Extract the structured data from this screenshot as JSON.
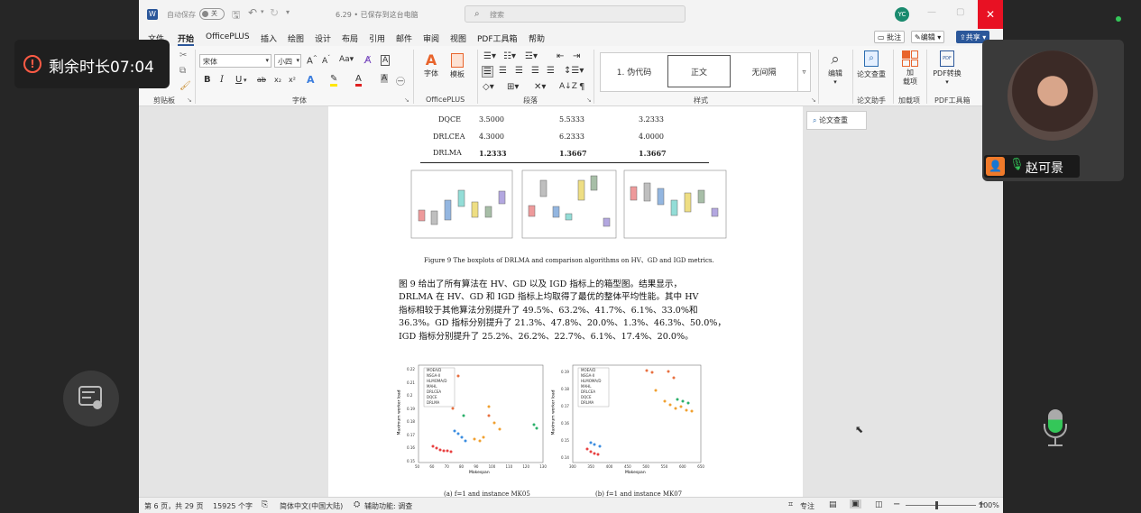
{
  "word": {
    "autosave_label": "自动保存",
    "autosave_state": "关",
    "doc_title": "6.29 • 已保存到这台电脑",
    "search_placeholder": "搜索",
    "user_initials": "YC",
    "menu": [
      "文件",
      "开始",
      "OfficePLUS",
      "插入",
      "绘图",
      "设计",
      "布局",
      "引用",
      "邮件",
      "审阅",
      "视图",
      "PDF工具箱",
      "帮助"
    ],
    "menu_active": "开始",
    "right_buttons": {
      "comment": "批注",
      "edit": "编辑",
      "share": "共享"
    },
    "ribbon": {
      "paste": "粘贴",
      "clipboard": "剪贴板",
      "font_name": "宋体",
      "font_size": "小四",
      "font_group": "字体",
      "officeplus_items": [
        "字体",
        "模板"
      ],
      "officeplus_group": "OfficePLUS",
      "paragraph_group": "段落",
      "styles": [
        "1.   伪代码",
        "正文",
        "无间隔"
      ],
      "styles_group": "样式",
      "edit": "编辑",
      "paper_check": "论文查重",
      "paper_assist": "论文助手",
      "addin": "加载项",
      "addin_btn": "加\n载项",
      "pdf_convert": "PDF转换",
      "pdf_group": "PDF工具箱",
      "font_glyphs": [
        "B",
        "I",
        "U",
        "ab",
        "x₂",
        "x²",
        "A",
        "A",
        "A",
        "A"
      ]
    },
    "side_panel_btn": "论文查重",
    "table_rows": [
      {
        "name": "DQCE",
        "v1": "3.5000",
        "v2": "5.5333",
        "v3": "3.2333"
      },
      {
        "name": "DRLCEA",
        "v1": "4.3000",
        "v2": "6.2333",
        "v3": "4.0000"
      },
      {
        "name": "DRLMA",
        "v1": "1.2333",
        "v2": "1.3667",
        "v3": "1.3667"
      }
    ],
    "figure9_caption": "Figure 9    The boxplots of DRLMA and comparison algorithms on HV、GD and IGD metrics.",
    "body_text": [
      "图  9  给出了所有算法在  HV、GD  以及 IGD 指标上的箱型图。结果显示，",
      "DRLMA  在  HV、GD 和  IGD  指标上均取得了最优的整体平均性能。其中 HV",
      "指标相较于其他算法分别提升了 49.5%、63.2%、41.7%、6.1%、33.0%和",
      "36.3%。GD  指标分别提升了 21.3%、47.8%、20.0%、1.3%、46.3%、50.0%，",
      "IGD  指标分别提升了 25.2%、26.2%、22.7%、6.1%、17.4%、20.0%。"
    ],
    "scatter_legend": [
      "MOEA/D",
      "NSGA-II",
      "HLMOMA/D",
      "MAHL",
      "DRLCEA",
      "DQCE",
      "DRLMA"
    ],
    "scatter_a": {
      "xlabel": "Makespan",
      "ylabel": "Maximum worker load",
      "xticks": [
        "50",
        "60",
        "70",
        "80",
        "90",
        "100",
        "110",
        "120",
        "130"
      ],
      "yticks": [
        "0.22",
        "0.21",
        "0.2",
        "0.19",
        "0.18",
        "0.17",
        "0.16",
        "0.15"
      ],
      "caption": "(a)    f=1 and instance MK05"
    },
    "scatter_b": {
      "xlabel": "Makespan",
      "ylabel": "Maximum worker load",
      "xticks": [
        "300",
        "350",
        "400",
        "450",
        "500",
        "550",
        "600",
        "650"
      ],
      "yticks": [
        "0.19",
        "0.18",
        "0.17",
        "0.16",
        "0.15",
        "0.14"
      ],
      "caption": "(b)    f=1 and instance MK07"
    },
    "status": {
      "page": "第 6 页，共 29 页",
      "words": "15925 个字",
      "lang": "简体中文(中国大陆)",
      "accessibility": "辅助功能: 调查",
      "focus": "专注",
      "zoom": "100%"
    }
  },
  "meeting": {
    "timer_text": "剩余时长07:04",
    "participant_name": "赵可景"
  },
  "colors": {
    "accent": "#2b579a",
    "close": "#e81123",
    "timer_icon": "#ff5b45"
  }
}
